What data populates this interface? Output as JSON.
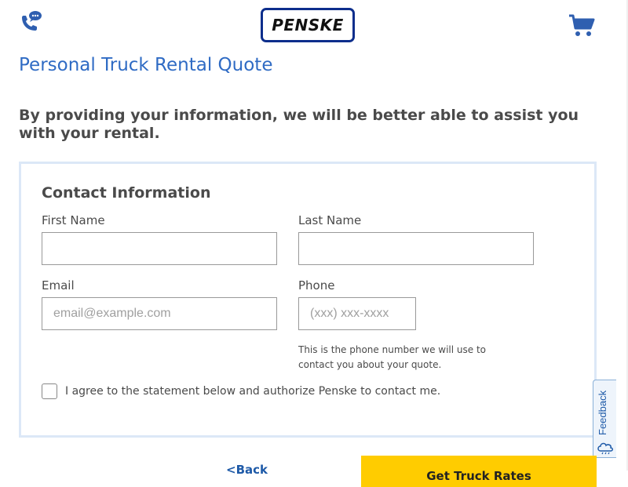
{
  "header": {
    "phone_icon": "phone-chat-icon",
    "logo_text": "PENSKE",
    "cart_icon": "cart-icon"
  },
  "page": {
    "title": "Personal Truck Rental Quote",
    "intro": "By providing your information, we will be better able to assist you with your rental."
  },
  "form": {
    "section_title": "Contact Information",
    "first_name": {
      "label": "First Name",
      "value": "",
      "placeholder": ""
    },
    "last_name": {
      "label": "Last Name",
      "value": "",
      "placeholder": ""
    },
    "email": {
      "label": "Email",
      "value": "",
      "placeholder": "email@example.com"
    },
    "phone": {
      "label": "Phone",
      "value": "",
      "placeholder": "(xxx) xxx-xxxx",
      "help_text": "This is the phone number we will use to contact you about your quote."
    },
    "consent": {
      "checked": false,
      "label": "I agree to the statement below and authorize Penske to contact me."
    }
  },
  "feedback": {
    "label": "Feedback",
    "icon": "feedback-cloud-icon"
  },
  "footer": {
    "back_label": "<Back",
    "primary_label": "Get Truck Rates"
  },
  "colors": {
    "brand_blue": "#0d2e8c",
    "title_blue": "#2f6bc4",
    "button_yellow": "#ffcc00",
    "card_border": "#dce8f7"
  }
}
